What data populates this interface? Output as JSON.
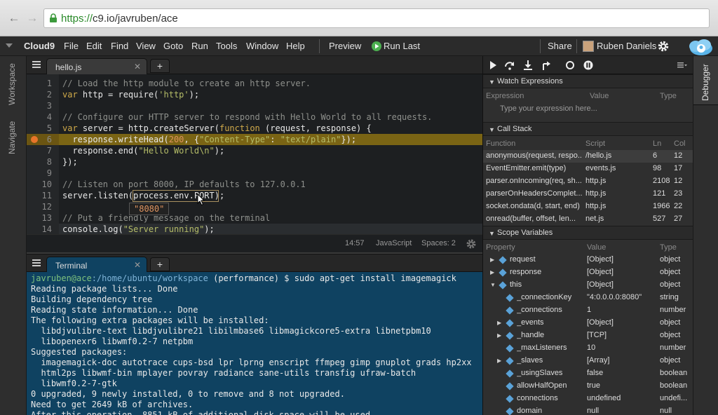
{
  "browser": {
    "url_scheme": "https://",
    "url_rest": "c9.io/javruben/ace"
  },
  "menubar": {
    "brand": "Cloud9",
    "items": [
      "File",
      "Edit",
      "Find",
      "View",
      "Goto",
      "Run",
      "Tools",
      "Window",
      "Help"
    ],
    "preview": "Preview",
    "run_last": "Run Last",
    "share": "Share",
    "user": "Ruben Daniels"
  },
  "left_tabs": [
    "Workspace",
    "Navigate"
  ],
  "editor": {
    "tab_label": "hello.js",
    "lines": [
      {
        "n": "1",
        "text": "// Load the http module to create an http server."
      },
      {
        "n": "2",
        "text": "var http = require('http');"
      },
      {
        "n": "3",
        "text": ""
      },
      {
        "n": "4",
        "text": "// Configure our HTTP server to respond with Hello World to all requests."
      },
      {
        "n": "5",
        "text": "var server = http.createServer(function (request, response) {"
      },
      {
        "n": "6",
        "text": "  response.writeHead(200, {\"Content-Type\": \"text/plain\"});"
      },
      {
        "n": "7",
        "text": "  response.end(\"Hello World\\n\");"
      },
      {
        "n": "8",
        "text": "});"
      },
      {
        "n": "9",
        "text": ""
      },
      {
        "n": "10",
        "text": "// Listen on port 8000, IP defaults to 127.0.0.1"
      },
      {
        "n": "11",
        "text": "server.listen(process.env.PORT);"
      },
      {
        "n": "12",
        "text": ""
      },
      {
        "n": "13",
        "text": "// Put a friendly message on the terminal"
      },
      {
        "n": "14",
        "text": "console.log(\"Server running\");"
      }
    ],
    "tooltip": "\"8080\"",
    "status_position": "14:57",
    "status_mode": "JavaScript",
    "status_spaces": "Spaces: 2"
  },
  "terminal": {
    "tab_label": "Terminal",
    "prompt_user": "javruben@ace",
    "prompt_path": ":/home/ubuntu/workspace",
    "prompt_cmd": " (performance) $ sudo apt-get install imagemagick",
    "lines": [
      "Reading package lists... Done",
      "Building dependency tree",
      "Reading state information... Done",
      "The following extra packages will be installed:",
      "  libdjvulibre-text libdjvulibre21 libilmbase6 libmagickcore5-extra libnetpbm10",
      "  libopenexr6 libwmf0.2-7 netpbm",
      "Suggested packages:",
      "  imagemagick-doc autotrace cups-bsd lpr lprng enscript ffmpeg gimp gnuplot grads hp2xx",
      "  html2ps libwmf-bin mplayer povray radiance sane-utils transfig ufraw-batch",
      "  libwmf0.2-7-gtk",
      "0 upgraded, 9 newly installed, 0 to remove and 8 not upgraded.",
      "Need to get 2649 kB of archives.",
      "After this operation, 8851 kB of additional disk space will be used."
    ]
  },
  "debugger": {
    "vtab": "Debugger",
    "watch": {
      "title": "Watch Expressions",
      "cols": [
        "Expression",
        "Value",
        "Type"
      ],
      "placeholder": "Type your expression here..."
    },
    "callstack": {
      "title": "Call Stack",
      "cols": [
        "Function",
        "Script",
        "Ln",
        "Col"
      ],
      "rows": [
        [
          "anonymous(request, respo...",
          "/hello.js",
          "6",
          "12"
        ],
        [
          "EventEmitter.emit(type)",
          "events.js",
          "98",
          "17"
        ],
        [
          "parser.onIncoming(req, sh...",
          "http.js",
          "2108",
          "12"
        ],
        [
          "parserOnHeadersComplet...",
          "http.js",
          "121",
          "23"
        ],
        [
          "socket.ondata(d, start, end)",
          "http.js",
          "1966",
          "22"
        ],
        [
          "onread(buffer, offset, len...",
          "net.js",
          "527",
          "27"
        ]
      ]
    },
    "scope": {
      "title": "Scope Variables",
      "cols": [
        "Property",
        "Value",
        "Type"
      ],
      "rows": [
        {
          "indent": 0,
          "exp": "right",
          "name": "request",
          "value": "[Object]",
          "type": "object"
        },
        {
          "indent": 0,
          "exp": "right",
          "name": "response",
          "value": "[Object]",
          "type": "object"
        },
        {
          "indent": 0,
          "exp": "down",
          "name": "this",
          "value": "[Object]",
          "type": "object"
        },
        {
          "indent": 1,
          "exp": "",
          "name": "_connectionKey",
          "value": "\"4:0.0.0.0:8080\"",
          "type": "string"
        },
        {
          "indent": 1,
          "exp": "",
          "name": "_connections",
          "value": "1",
          "type": "number"
        },
        {
          "indent": 1,
          "exp": "right",
          "name": "_events",
          "value": "[Object]",
          "type": "object"
        },
        {
          "indent": 1,
          "exp": "right",
          "name": "_handle",
          "value": "[TCP]",
          "type": "object"
        },
        {
          "indent": 1,
          "exp": "",
          "name": "_maxListeners",
          "value": "10",
          "type": "number"
        },
        {
          "indent": 1,
          "exp": "right",
          "name": "_slaves",
          "value": "[Array]",
          "type": "object"
        },
        {
          "indent": 1,
          "exp": "",
          "name": "_usingSlaves",
          "value": "false",
          "type": "boolean"
        },
        {
          "indent": 1,
          "exp": "",
          "name": "allowHalfOpen",
          "value": "true",
          "type": "boolean"
        },
        {
          "indent": 1,
          "exp": "",
          "name": "connections",
          "value": "undefined",
          "type": "undefi..."
        },
        {
          "indent": 1,
          "exp": "",
          "name": "domain",
          "value": "null",
          "type": "null"
        }
      ]
    }
  }
}
